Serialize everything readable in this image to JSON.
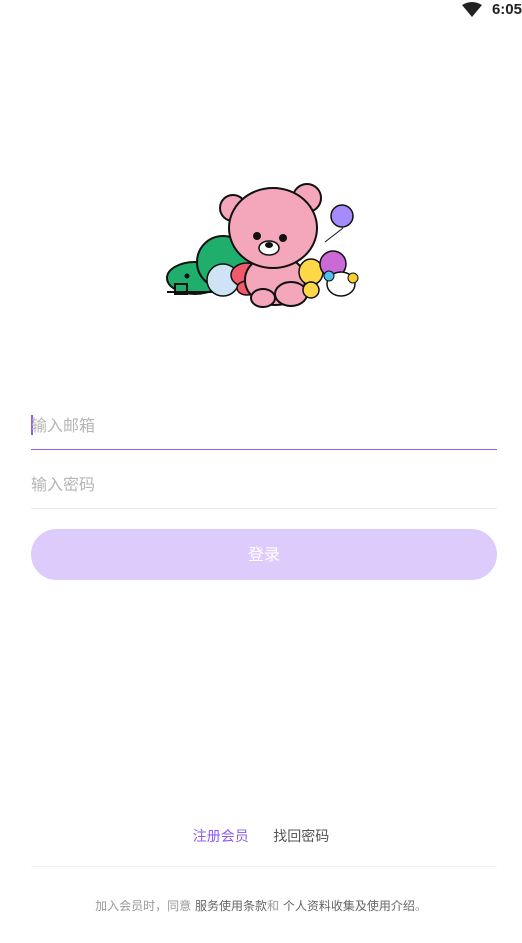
{
  "status_bar": {
    "time": "6:05",
    "wifi_icon": "wifi-icon"
  },
  "mascot": {
    "icon": "mascot-illustration"
  },
  "form": {
    "email_placeholder": "输入邮箱",
    "password_placeholder": "输入密码",
    "login_label": "登录"
  },
  "links": {
    "register": "注册会员",
    "forgot": "找回密码"
  },
  "footer": {
    "prefix": "加入会员时，同意 ",
    "terms": "服务使用条款",
    "and": "和 ",
    "privacy": "个人资料收集及使用介绍",
    "suffix": "。"
  },
  "colors": {
    "accent": "#8b5cf6",
    "button_disabled": "#dccbfb"
  }
}
